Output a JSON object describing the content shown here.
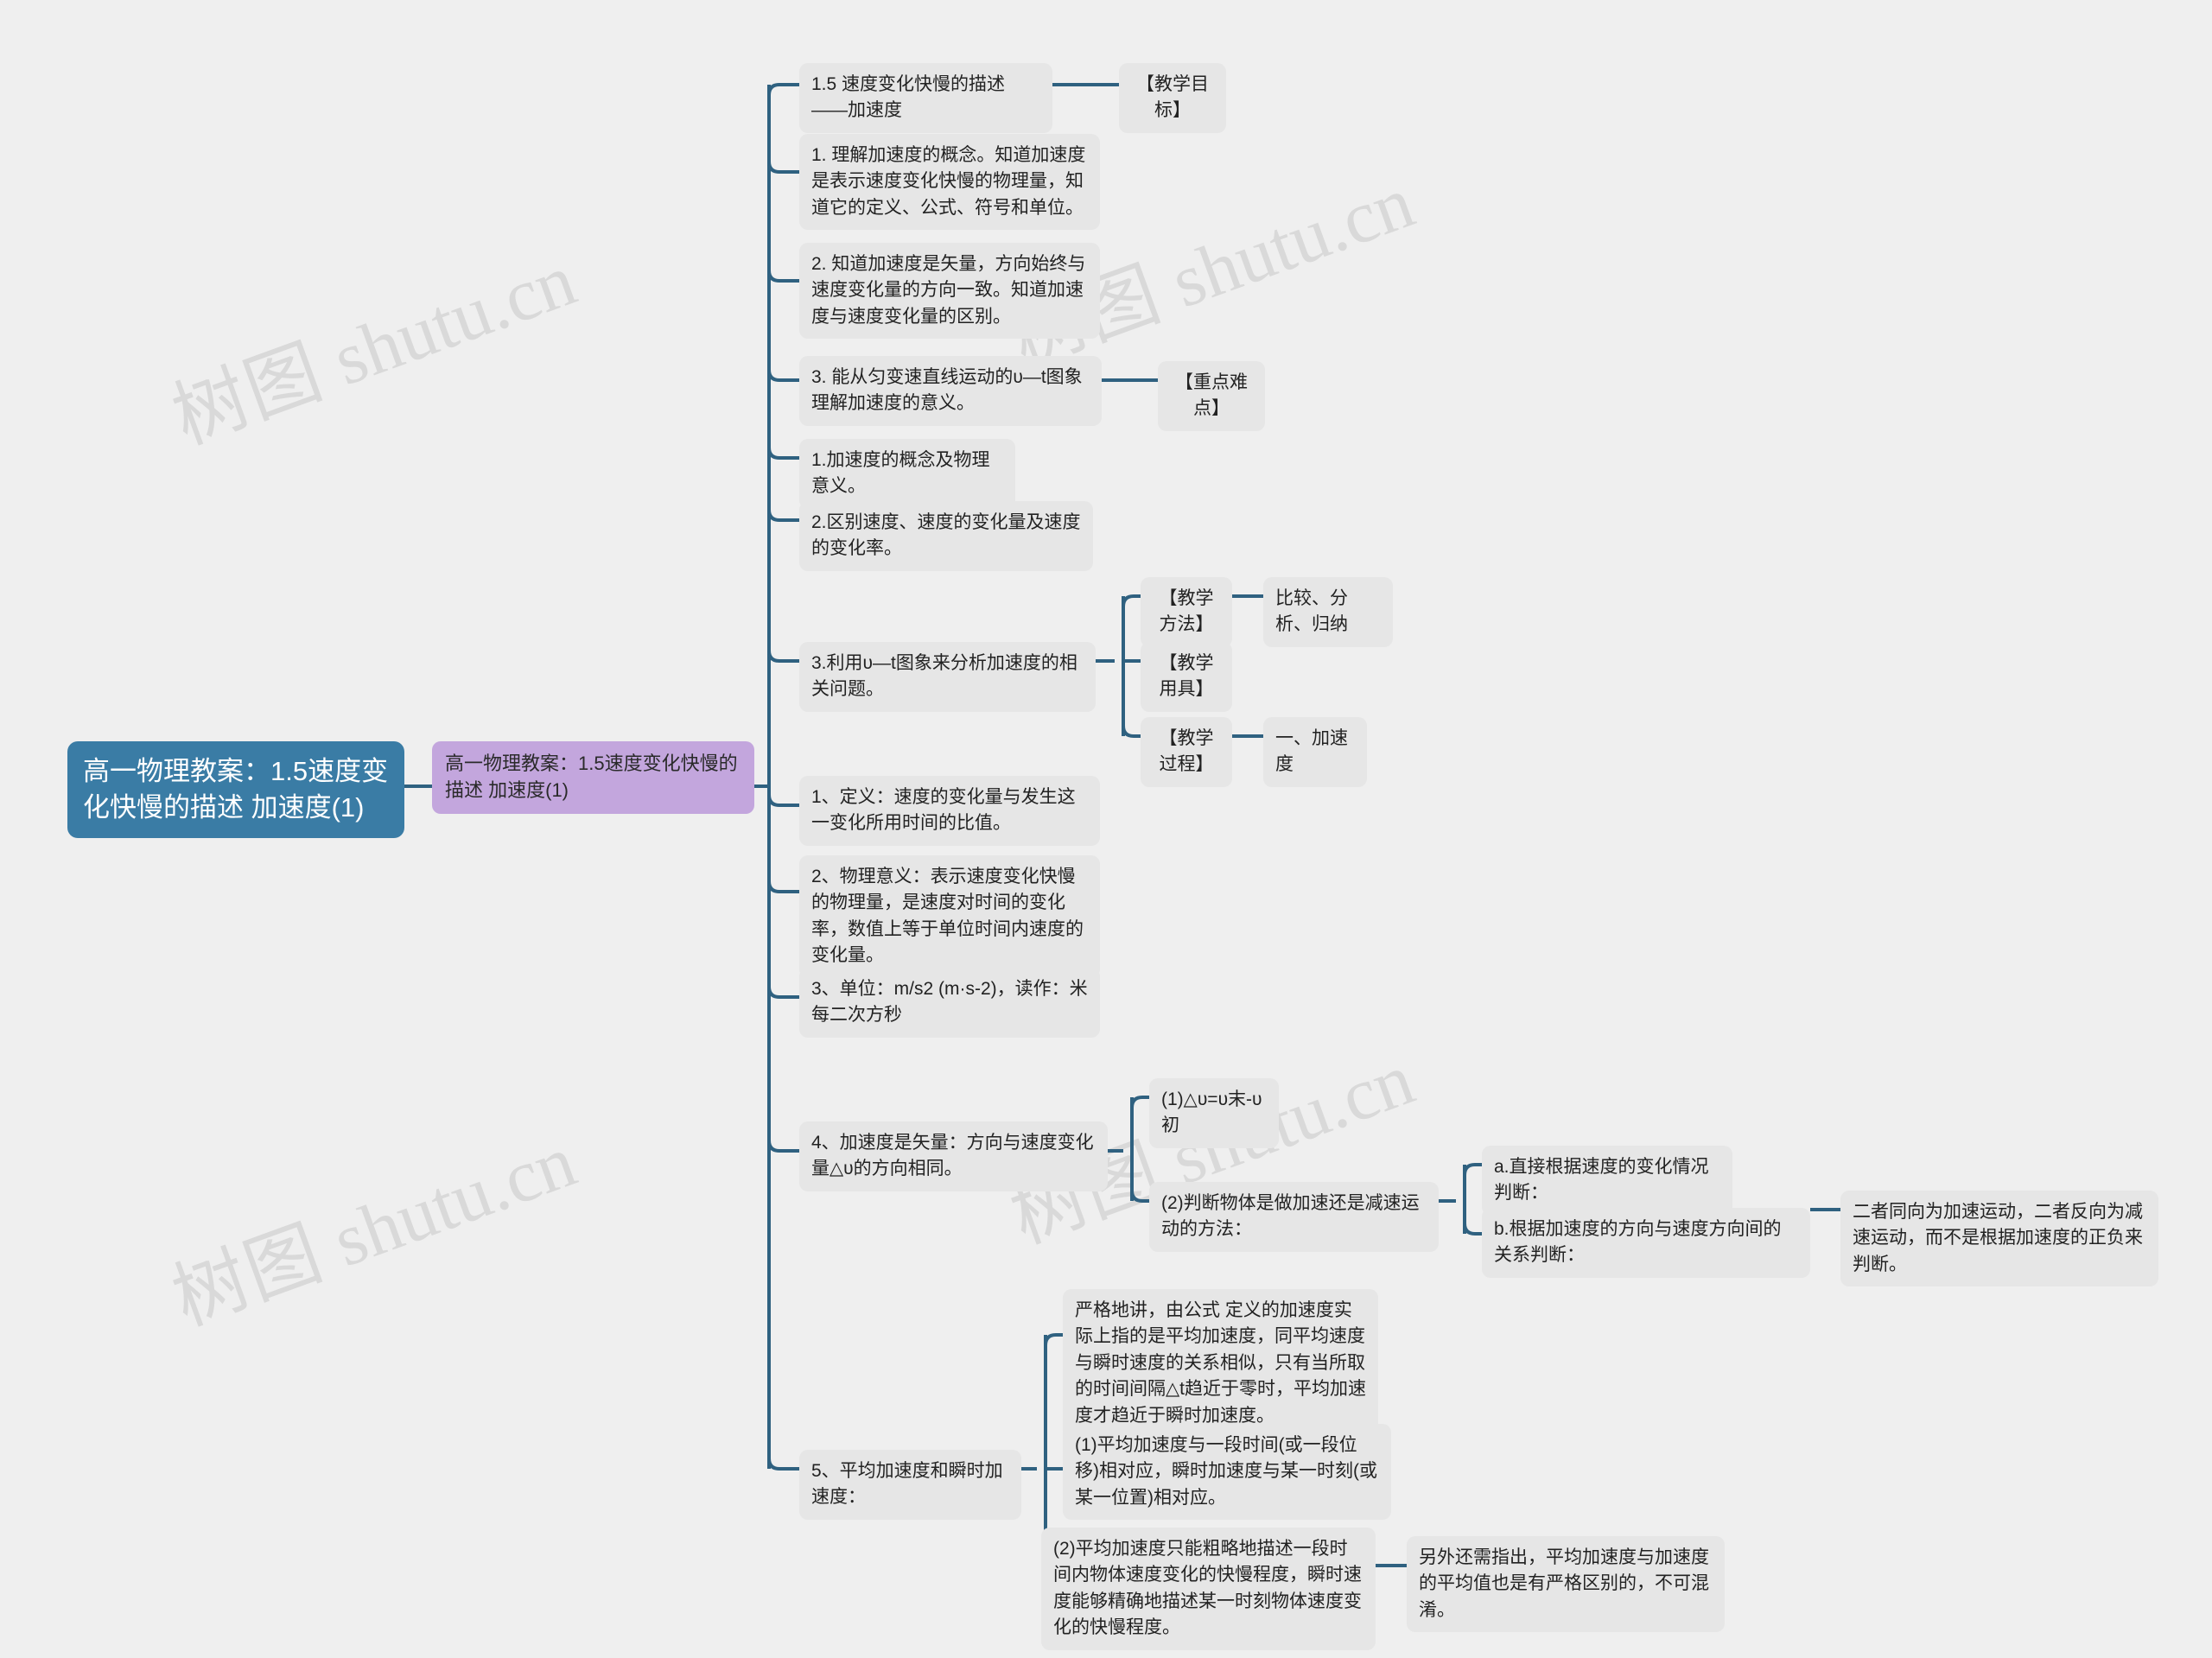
{
  "meta": {
    "watermark_text": "树图 shutu.cn",
    "background_color": "#efefef",
    "root_color": "#3a7ca5",
    "branch_color": "#c3a6dd",
    "node_color": "#e6e6e6",
    "link_color": "#2f6180"
  },
  "root": {
    "label": "高一物理教案：1.5速度变化快慢的描述 加速度(1)"
  },
  "branch": {
    "label": "高一物理教案：1.5速度变化快慢的描述 加速度(1)"
  },
  "nodes": {
    "title": "1.5 速度变化快慢的描述——加速度",
    "goal_tag": "【教学目标】",
    "goal1": "1. 理解加速度的概念。知道加速度是表示速度变化快慢的物理量，知道它的定义、公式、符号和单位。",
    "goal2": "2. 知道加速度是矢量，方向始终与速度变化量的方向一致。知道加速度与速度变化量的区别。",
    "goal3": "3. 能从匀变速直线运动的υ—t图象理解加速度的意义。",
    "keypoint_tag": "【重点难点】",
    "key1": "1.加速度的概念及物理意义。",
    "key2": "2.区别速度、速度的变化量及速度的变化率。",
    "key3": "3.利用υ—t图象来分析加速度的相关问题。",
    "method_tag": "【教学方法】",
    "method_value": "比较、分析、归纳",
    "tools_tag": "【教学用具】",
    "process_tag": "【教学过程】",
    "process_value": "一、加速度",
    "def1": "1、定义：速度的变化量与发生这一变化所用时间的比值。",
    "def2": "2、物理意义：表示速度变化快慢的物理量，是速度对时间的变化率，数值上等于单位时间内速度的变化量。",
    "def3": "3、单位：m/s2 (m·s-2)，读作：米每二次方秒",
    "def4": "4、加速度是矢量：方向与速度变化量△υ的方向相同。",
    "vec1": "(1)△υ=υ末-υ初",
    "vec2": "(2)判断物体是做加速还是减速运动的方法：",
    "vec2a": "a.直接根据速度的变化情况判断：",
    "vec2b": "b.根据加速度的方向与速度方向间的关系判断：",
    "vec2b_detail": "二者同向为加速运动，二者反向为减速运动，而不是根据加速度的正负来判断。",
    "def5": "5、平均加速度和瞬时加速度：",
    "avg_note": "严格地讲，由公式 定义的加速度实际上指的是平均加速度，同平均速度与瞬时速度的关系相似，只有当所取的时间间隔△t趋近于零时，平均加速度才趋近于瞬时加速度。",
    "avg1": "(1)平均加速度与一段时间(或一段位移)相对应，瞬时加速度与某一时刻(或某一位置)相对应。",
    "avg2": "(2)平均加速度只能粗略地描述一段时间内物体速度变化的快慢程度，瞬时速度能够精确地描述某一时刻物体速度变化的快慢程度。",
    "avg2_detail": "另外还需指出，平均加速度与加速度的平均值也是有严格区别的，不可混淆。"
  }
}
